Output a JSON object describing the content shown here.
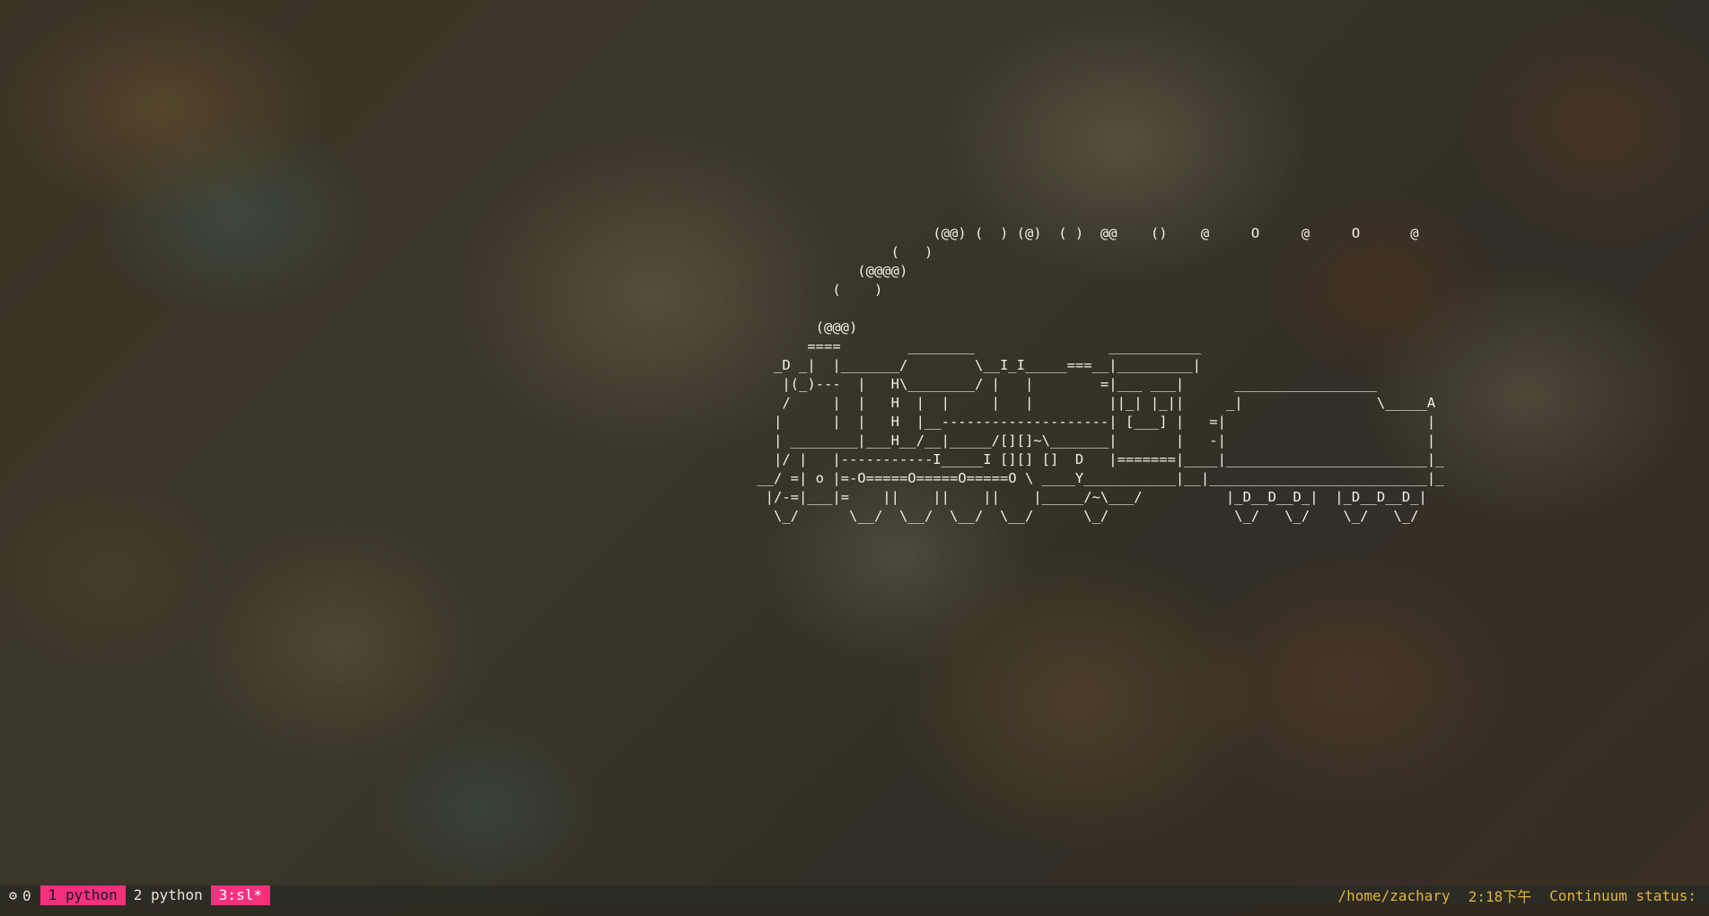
{
  "terminal": {
    "sl_art": [
      "                         (@@) (  ) (@)  ( )  @@    ()    @     O     @     O      @",
      "                    (   )",
      "                (@@@@)",
      "             (    )",
      "",
      "           (@@@)",
      "          ====        ________                ___________",
      "      _D _|  |_______/        \\__I_I_____===__|_________|",
      "       |(_)---  |   H\\________/ |   |        =|___ ___|      _________________",
      "       /     |  |   H  |  |     |   |         ||_| |_||     _|                \\_____A",
      "      |      |  |   H  |__--------------------| [___] |   =|                        |",
      "      | ________|___H__/__|_____/[][]~\\_______|       |   -|                        |",
      "      |/ |   |-----------I_____I [][] []  D   |=======|____|________________________|_",
      "    __/ =| o |=-O=====O=====O=====O \\ ____Y___________|__|__________________________|_",
      "     |/-=|___|=    ||    ||    ||    |_____/~\\___/          |_D__D__D_|  |_D__D__D_|",
      "      \\_/      \\__/  \\__/  \\__/  \\__/      \\_/               \\_/   \\_/    \\_/   \\_/"
    ]
  },
  "status_bar": {
    "session_icon": "⚙",
    "session_index": "0",
    "windows": [
      {
        "label": "1 python"
      },
      {
        "label": "2 python"
      },
      {
        "label": "3:sl*"
      }
    ],
    "path": "/home/zachary",
    "time": "2:18下午",
    "continuum": "Continuum status:"
  },
  "colors": {
    "accent": "#f5317d",
    "status_bg": "#2b2b24",
    "status_right_text": "#e3b23c",
    "art_text": "#f2efe6"
  }
}
